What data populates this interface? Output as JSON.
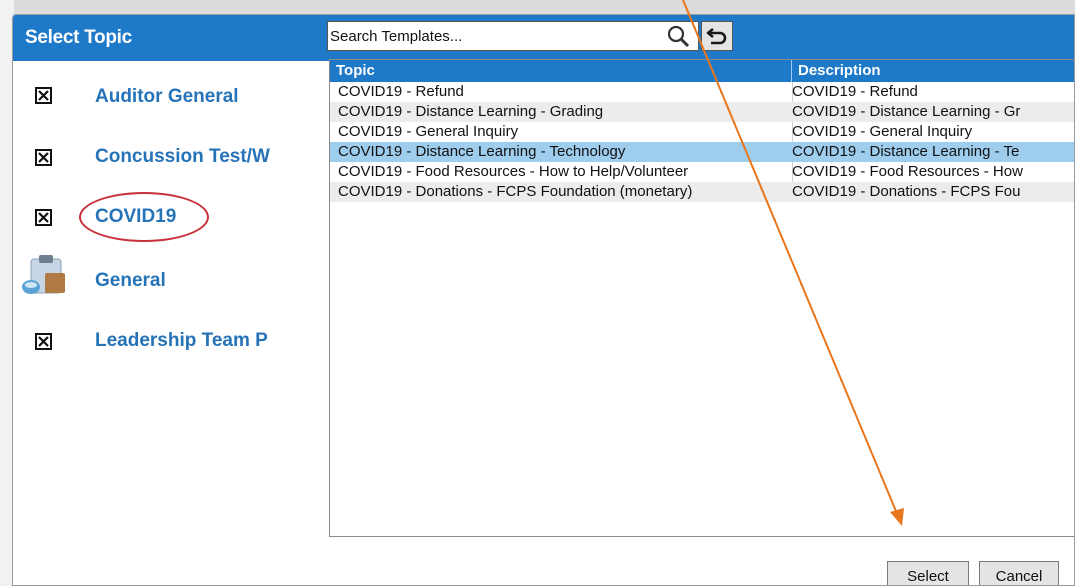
{
  "dialog": {
    "title": "Select Topic",
    "accent_color": "#1e79c8"
  },
  "search": {
    "placeholder": "Search Templates..."
  },
  "topics": [
    {
      "label": "Auditor General",
      "icon": "x-box-icon"
    },
    {
      "label": "Concussion Test/W",
      "icon": "x-box-icon"
    },
    {
      "label": "COVID19",
      "icon": "x-box-icon",
      "highlighted": true
    },
    {
      "label": "General",
      "icon": "clipboard-icon"
    },
    {
      "label": "Leadership Team P",
      "icon": "x-box-icon"
    }
  ],
  "grid": {
    "columns": [
      "Topic",
      "Description"
    ],
    "rows": [
      {
        "topic": "COVID19 - Refund",
        "description": "COVID19 - Refund"
      },
      {
        "topic": "COVID19 - Distance Learning - Grading",
        "description": "COVID19 - Distance Learning - Gr"
      },
      {
        "topic": "COVID19 - General Inquiry",
        "description": "COVID19 - General Inquiry"
      },
      {
        "topic": "COVID19 - Distance Learning - Technology",
        "description": "COVID19 - Distance Learning - Te",
        "selected": true
      },
      {
        "topic": "COVID19 - Food Resources - How to Help/Volunteer",
        "description": "COVID19 - Food Resources - How"
      },
      {
        "topic": "COVID19 - Donations - FCPS Foundation (monetary)",
        "description": "COVID19 - Donations - FCPS Fou"
      }
    ]
  },
  "buttons": {
    "select": "Select",
    "cancel": "Cancel"
  },
  "annotation": {
    "circle_color": "#c8303a",
    "arrow_color": "#e8761c"
  }
}
